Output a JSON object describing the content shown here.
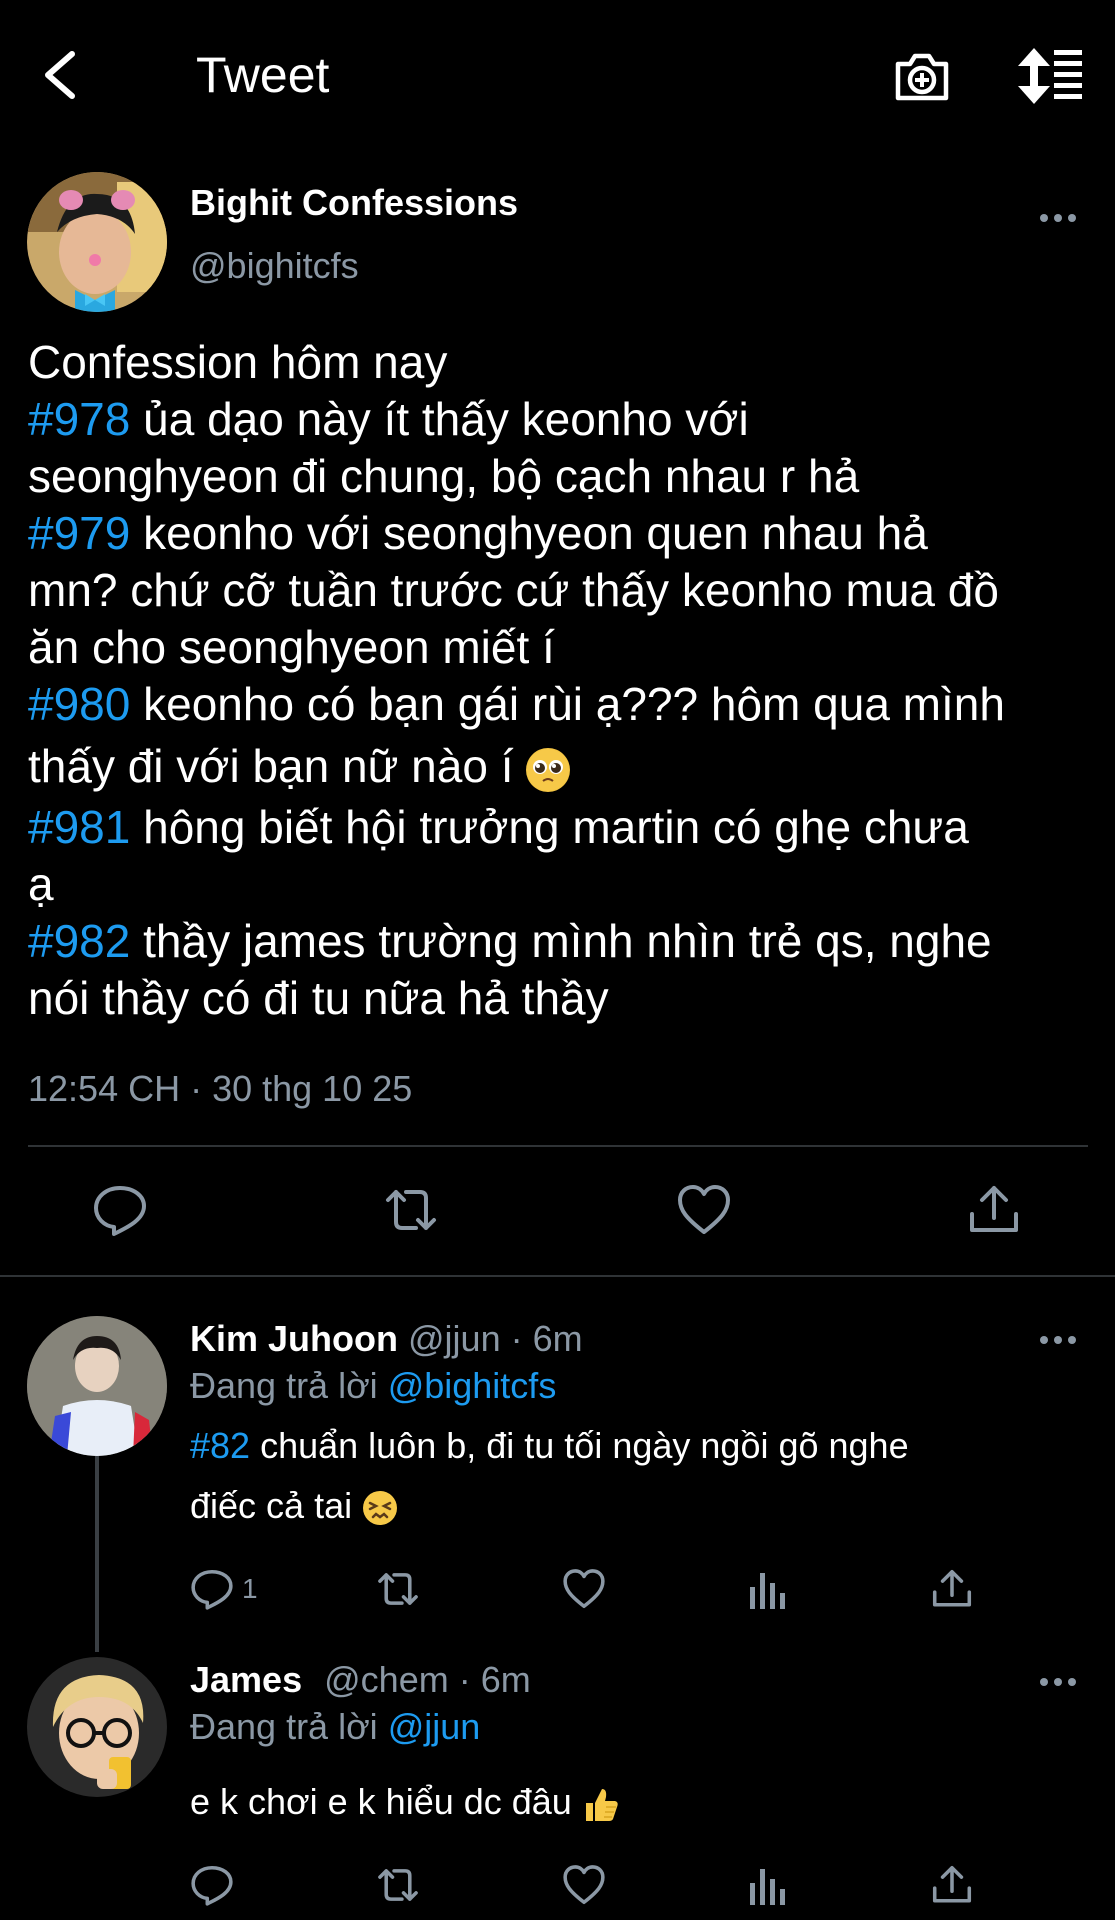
{
  "header": {
    "title": "Tweet",
    "back_icon": "chevron-left-icon",
    "camera_icon": "camera-plus-icon",
    "sort_icon": "sort-icon"
  },
  "tweet": {
    "display_name": "Bighit Confessions",
    "handle": "@bighitcfs",
    "lines": [
      {
        "tag": "",
        "text": "Confession hôm nay"
      },
      {
        "tag": "#978",
        "text": " ủa dạo này ít thấy keonho với"
      },
      {
        "tag": "",
        "text": "seonghyeon đi chung, bộ cạch nhau r hả"
      },
      {
        "tag": "#979",
        "text": " keonho với seonghyeon quen nhau hả"
      },
      {
        "tag": "",
        "text": "mn? chứ cỡ tuần trước cứ thấy keonho mua đồ"
      },
      {
        "tag": "",
        "text": "ăn cho seonghyeon miết í"
      },
      {
        "tag": "#980",
        "text": " keonho có bạn gái rùi ạ??? hôm qua mình"
      },
      {
        "tag": "",
        "text": "thấy đi với bạn nữ nào í"
      },
      {
        "tag": "#981",
        "text": " hông biết hội trưởng martin có ghẹ chưa"
      },
      {
        "tag": "",
        "text": "ạ"
      },
      {
        "tag": "#982",
        "text": " thầy james trường mình nhìn trẻ qs, nghe"
      },
      {
        "tag": "",
        "text": "nói thầy có đi tu nữa hả thầy"
      }
    ],
    "emoji": "pleading-face-emoji",
    "timestamp": "12:54 CH · 30 thg 10 25"
  },
  "replies": [
    {
      "name": "Kim Juhoon",
      "handle_time": "@jjun · 6m",
      "replying_label": "Đang trả lời",
      "replying_to": "@bighitcfs",
      "tag": "#82",
      "text_line1": " chuẩn luôn b, đi tu tối ngày ngồi gõ nghe",
      "text_line2": "điếc cả tai",
      "emoji": "persevering-face-emoji",
      "reply_count": "1"
    },
    {
      "name": "James",
      "handle_time": "@chem · 6m",
      "replying_label": "Đang trả lời",
      "replying_to": "@jjun",
      "text_line1": "e k chơi e k hiểu dc đâu",
      "emoji": "thumbs-up-emoji",
      "reply_count": ""
    }
  ],
  "colors": {
    "background": "#000000",
    "text": "#ffffff",
    "secondary": "#8b98a5",
    "accent": "#1d9bf0",
    "divider": "#2f3336"
  }
}
